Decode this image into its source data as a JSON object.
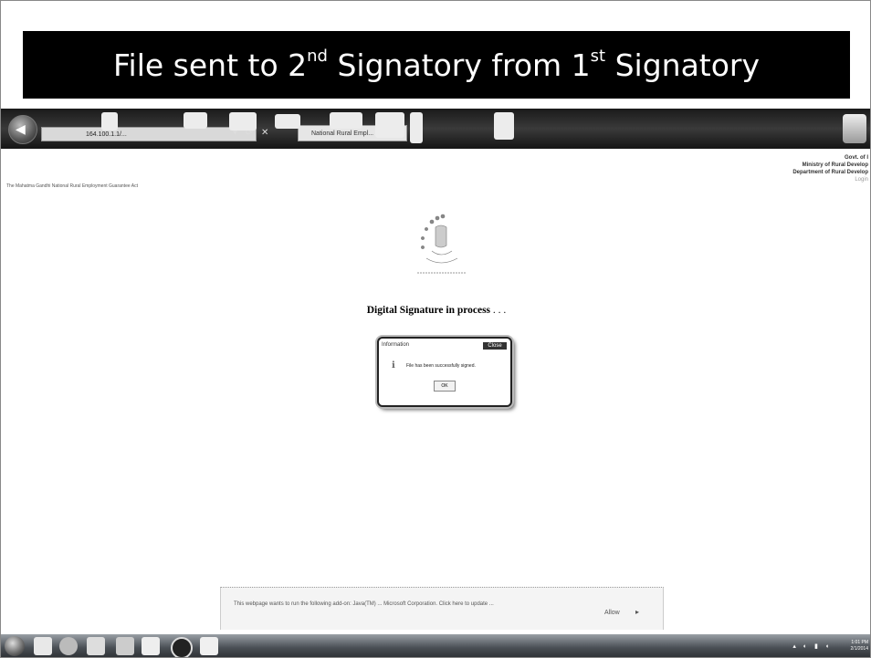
{
  "slide": {
    "title_main": "File sent to 2",
    "title_sup1": "nd",
    "title_mid": " Signatory from 1",
    "title_sup2": "st",
    "title_end": " Signatory"
  },
  "browser": {
    "address_text": "164.100.1.1/...",
    "tab_label": "National Rural Empl..."
  },
  "page": {
    "breadcrumb": "The Mahatma Gandhi National Rural Employment Guarantee Act",
    "gov_line1": "Govt. of I",
    "gov_line2": "Ministry of Rural Develop",
    "gov_line3": "Department of Rural Develop",
    "gov_line4": "Login",
    "status_text": "Digital Signature in process",
    "status_dots": " . . ."
  },
  "dialog": {
    "title": "Information",
    "close_label": "Close",
    "message": "File has been successfully signed.",
    "ok_label": "OK"
  },
  "notification": {
    "message": "This webpage wants to run the following add-on: Java(TM) ... Microsoft Corporation. Click here to update ...",
    "allow_label": "Allow"
  },
  "taskbar": {
    "time": "1:01 PM",
    "date": "2/1/2014"
  },
  "colors": {
    "banner_bg": "#000000",
    "banner_text": "#ffffff",
    "toolbar_bg": "#1a1a1a"
  }
}
